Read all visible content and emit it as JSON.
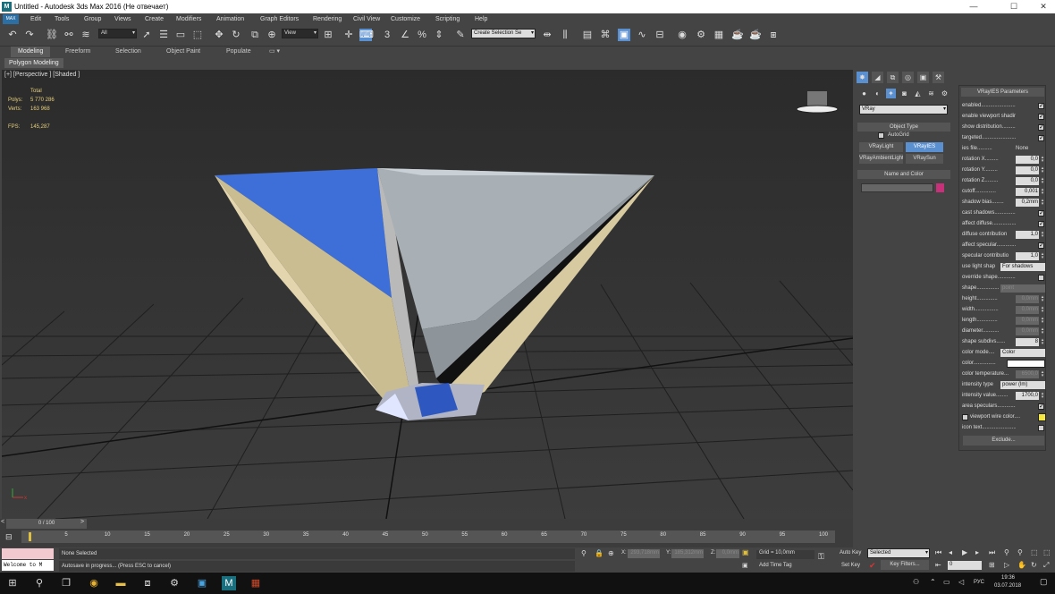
{
  "window": {
    "title": "Untitled - Autodesk 3ds Max 2016  (Не отвечает)",
    "app_icon": "3ds-max-icon",
    "controls": [
      "—",
      "☐",
      "✕"
    ]
  },
  "menu": {
    "max_button": "MAX",
    "items": [
      "Edit",
      "Tools",
      "Group",
      "Views",
      "Create",
      "Modifiers",
      "Animation",
      "Graph Editors",
      "Rendering",
      "Civil View",
      "Customize",
      "Scripting",
      "Help"
    ]
  },
  "toolbar": {
    "filter": "All",
    "ref_coord": "View",
    "selection_set": "Create Selection Se"
  },
  "ribbon": {
    "tabs": [
      "Modeling",
      "Freeform",
      "Selection",
      "Object Paint",
      "Populate"
    ],
    "panel": "Polygon Modeling"
  },
  "viewport": {
    "label": "[+] [Perspective ] [Shaded ]",
    "stats": {
      "header": "Total",
      "polys_label": "Polys:",
      "polys": "5 770 286",
      "verts_label": "Verts:",
      "verts": "163 968",
      "fps_label": "FPS:",
      "fps": "145,287"
    }
  },
  "command_panel": {
    "renderer": "VRay",
    "object_type": {
      "header": "Object Type",
      "autogrid": "AutoGrid",
      "buttons": [
        "VRayLight",
        "VRayIES",
        "VRayAmbientLight",
        "VRaySun"
      ]
    },
    "name_color": {
      "header": "Name and Color",
      "swatch": "#c8307a"
    }
  },
  "vrayies": {
    "header": "VRayIES Parameters",
    "rows": [
      {
        "label": "enabled........................",
        "type": "check",
        "value": true
      },
      {
        "label": "enable viewport shading....",
        "type": "check",
        "value": true
      },
      {
        "label": "show distribution............",
        "type": "check",
        "value": true
      },
      {
        "label": "targeted.........................",
        "type": "check",
        "value": true
      },
      {
        "label": "ies file..........",
        "type": "text",
        "value": "None"
      },
      {
        "label": "rotation X.........",
        "type": "spin",
        "value": "0,0"
      },
      {
        "label": "rotation Y.........",
        "type": "spin",
        "value": "0,0"
      },
      {
        "label": "rotation Z.........",
        "type": "spin",
        "value": "0,0"
      },
      {
        "label": "cutoff..............",
        "type": "spin",
        "value": "0,001"
      },
      {
        "label": "shadow bias........",
        "type": "spin",
        "value": "0,2mm"
      },
      {
        "label": "cast shadows......................",
        "type": "check",
        "value": true
      },
      {
        "label": "affect diffuse.....................",
        "type": "check",
        "value": true
      },
      {
        "label": "diffuse contribution",
        "type": "spin",
        "value": "1,0"
      },
      {
        "label": "affect specular....................",
        "type": "check",
        "value": true
      },
      {
        "label": "specular contributio",
        "type": "spin",
        "value": "1,0"
      },
      {
        "label": "use light shap",
        "type": "drop",
        "value": "For shadows"
      },
      {
        "label": "override shape....................",
        "type": "check",
        "value": false
      },
      {
        "label": "shape...............",
        "type": "dis",
        "value": "point"
      },
      {
        "label": "height..............",
        "type": "spind",
        "value": "0,0mm"
      },
      {
        "label": "width................",
        "type": "spind",
        "value": "0,0mm"
      },
      {
        "label": "length..............",
        "type": "spind",
        "value": "0,0mm"
      },
      {
        "label": "diameter...........",
        "type": "spind",
        "value": "0,0mm"
      },
      {
        "label": "shape subdivs......",
        "type": "spin",
        "value": "8"
      },
      {
        "label": "color mode....",
        "type": "drop",
        "value": "Color"
      },
      {
        "label": "color...............",
        "type": "swatch",
        "value": "#ffffff"
      },
      {
        "label": "color temperature...",
        "type": "spind",
        "value": "6500,0"
      },
      {
        "label": "intensity type",
        "type": "drop",
        "value": "power (lm)"
      },
      {
        "label": "intensity value........",
        "type": "spin",
        "value": "1700,0"
      },
      {
        "label": "area speculars.....................",
        "type": "check",
        "value": true
      },
      {
        "label": "viewport wire color....",
        "type": "swatchc",
        "value": "#f5e642"
      },
      {
        "label": "icon text..............................",
        "type": "check",
        "value": false
      }
    ],
    "exclude": "Exclude..."
  },
  "timeline": {
    "frame": "0 / 100",
    "ticks": [
      "0",
      "5",
      "10",
      "15",
      "20",
      "25",
      "30",
      "35",
      "40",
      "45",
      "50",
      "55",
      "60",
      "65",
      "70",
      "75",
      "80",
      "85",
      "90",
      "95",
      "100"
    ]
  },
  "status": {
    "listener": "Welcome to M",
    "selection": "None Selected",
    "prompt": "Autosave in progress... (Press ESC to cancel)",
    "x_label": "X:",
    "x": "293,718mm",
    "y_label": "Y:",
    "y": "185,312mm",
    "z_label": "Z:",
    "z": "0,0mm",
    "grid": "Grid = 10,0mm",
    "add_time_tag": "Add Time Tag",
    "auto_key": "Auto Key",
    "set_key": "Set Key",
    "key_mode": "Selected",
    "key_filters": "Key Filters...",
    "frame_value": "0"
  },
  "taskbar": {
    "time": "19:36",
    "date": "03.07.2018",
    "lang": "РУС"
  }
}
